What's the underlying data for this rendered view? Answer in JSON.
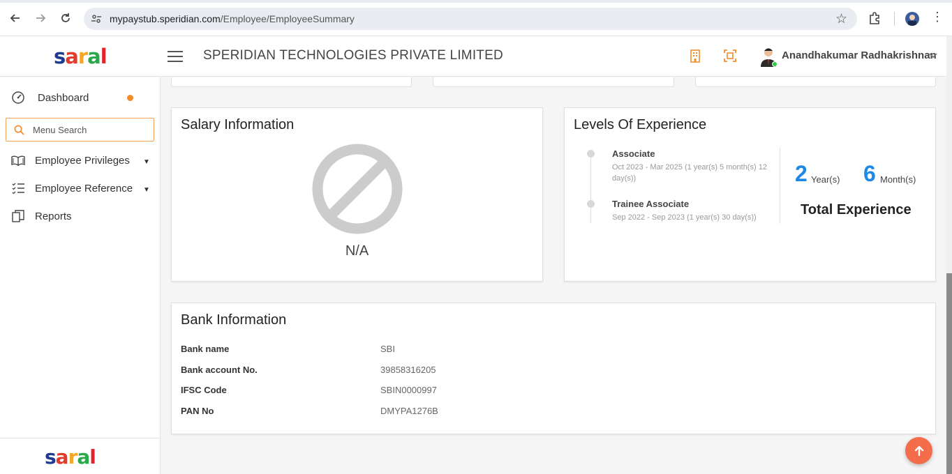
{
  "browser": {
    "url_host": "mypaystub.speridian.com",
    "url_path": "/Employee/EmployeeSummary"
  },
  "header": {
    "logo_letters": [
      "s",
      "a",
      "r",
      "a",
      "l"
    ],
    "logo_colors": [
      "#1f3b8f",
      "#e23b2e",
      "#f5a623",
      "#2aa84a",
      "#e2242b"
    ],
    "company": "SPERIDIAN TECHNOLOGIES PRIVATE LIMITED",
    "user_name": "Anandhakumar Radhakrishnan",
    "accent_color": "#f58c2c"
  },
  "sidebar": {
    "dashboard_label": "Dashboard",
    "search_placeholder": "Menu Search",
    "items": [
      {
        "label": "Employee Privileges",
        "icon": "book-icon",
        "has_caret": true
      },
      {
        "label": "Employee Reference",
        "icon": "checklist-icon",
        "has_caret": true
      },
      {
        "label": "Reports",
        "icon": "copy-icon",
        "has_caret": false
      }
    ]
  },
  "salary": {
    "title": "Salary Information",
    "value": "N/A"
  },
  "experience": {
    "title": "Levels Of Experience",
    "levels": [
      {
        "role": "Associate",
        "period": "Oct 2023 - Mar 2025 (1 year(s) 5 month(s) 12 day(s))"
      },
      {
        "role": "Trainee Associate",
        "period": "Sep 2022 - Sep 2023 (1 year(s) 30 day(s))"
      }
    ],
    "years": "2",
    "years_unit": "Year(s)",
    "months": "6",
    "months_unit": "Month(s)",
    "total_label": "Total Experience"
  },
  "bank": {
    "title": "Bank Information",
    "rows": [
      {
        "label": "Bank name",
        "value": "SBI"
      },
      {
        "label": "Bank account No.",
        "value": "39858316205"
      },
      {
        "label": "IFSC Code",
        "value": "SBIN0000997"
      },
      {
        "label": "PAN No",
        "value": "DMYPA1276B"
      }
    ]
  }
}
